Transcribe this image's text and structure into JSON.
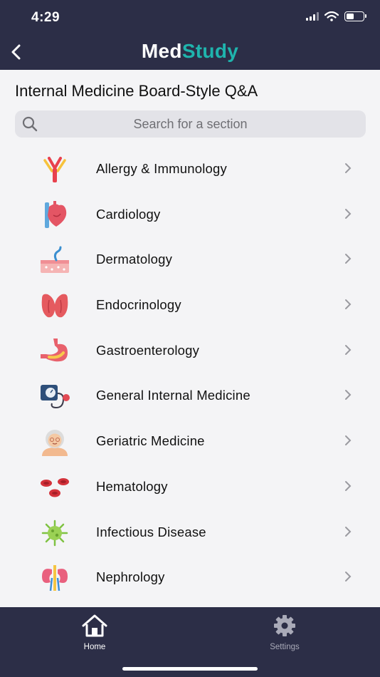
{
  "status_bar": {
    "time": "4:29",
    "battery_level": 0.45
  },
  "header": {
    "logo_part1": "Med",
    "logo_part2": "Study",
    "brand_color": "#1fb4ad",
    "background": "#2c2e47"
  },
  "page": {
    "title": "Internal Medicine Board-Style Q&A"
  },
  "search": {
    "placeholder": "Search for a section",
    "value": ""
  },
  "sections": [
    {
      "label": "Allergy & Immunology",
      "icon": "antibody-icon"
    },
    {
      "label": "Cardiology",
      "icon": "heart-icon"
    },
    {
      "label": "Dermatology",
      "icon": "skin-layer-icon"
    },
    {
      "label": "Endocrinology",
      "icon": "thyroid-icon"
    },
    {
      "label": "Gastroenterology",
      "icon": "stomach-icon"
    },
    {
      "label": "General Internal Medicine",
      "icon": "blood-pressure-monitor-icon"
    },
    {
      "label": "Geriatric Medicine",
      "icon": "elderly-woman-icon"
    },
    {
      "label": "Hematology",
      "icon": "red-blood-cells-icon"
    },
    {
      "label": "Infectious Disease",
      "icon": "virus-icon"
    },
    {
      "label": "Nephrology",
      "icon": "kidneys-icon"
    }
  ],
  "tabbar": {
    "home_label": "Home",
    "settings_label": "Settings",
    "active_tab": "Home"
  }
}
